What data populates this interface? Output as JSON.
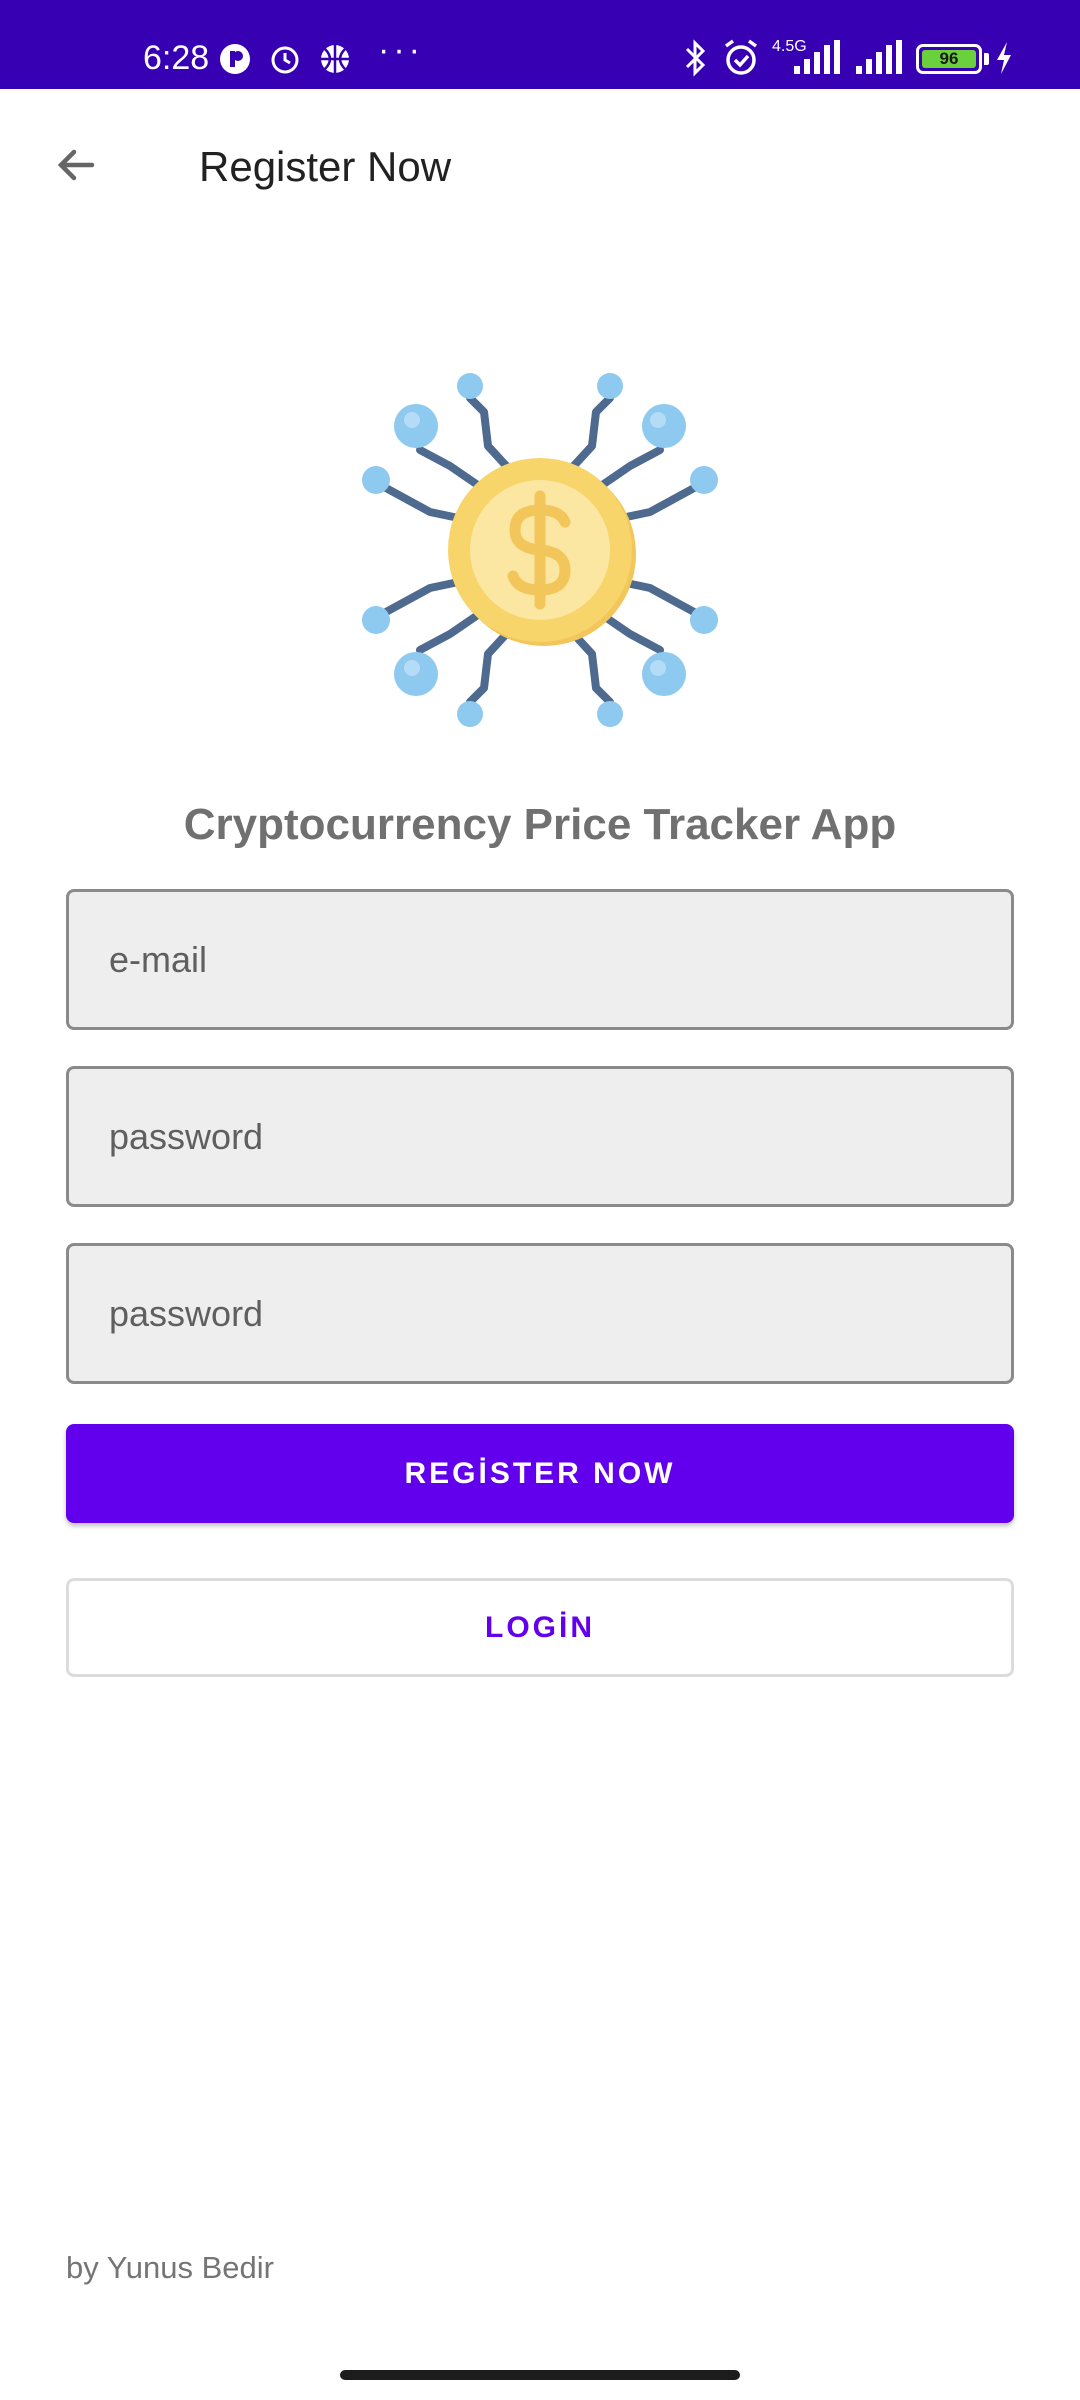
{
  "status_bar": {
    "time": "6:28",
    "network": "4.5G",
    "battery": "96",
    "icons": [
      "notification-icon",
      "alarm-icon",
      "basketball-icon",
      "bluetooth-icon",
      "alarm-icon",
      "signal-icon",
      "signal-icon",
      "battery-icon",
      "charging-icon"
    ],
    "dots": "···"
  },
  "app_bar": {
    "title": "Register Now",
    "back_icon": "arrow-back-icon"
  },
  "logo_icon": "crypto-coin-icon",
  "headline": "Cryptocurrency Price Tracker App",
  "form": {
    "email_placeholder": "e-mail",
    "password_placeholder": "password",
    "confirm_password_placeholder": "password",
    "email_value": "",
    "password_value": "",
    "confirm_password_value": ""
  },
  "buttons": {
    "register_label": "REGİSTER NOW",
    "login_label": "LOGİN"
  },
  "footer": "by Yunus Bedir",
  "colors": {
    "status_bar": "#3700b3",
    "primary": "#6200ee",
    "field_bg": "#eeeeee",
    "coin": "#f7d56a",
    "node": "#8ec9f0",
    "circuit": "#4e6a8f"
  }
}
